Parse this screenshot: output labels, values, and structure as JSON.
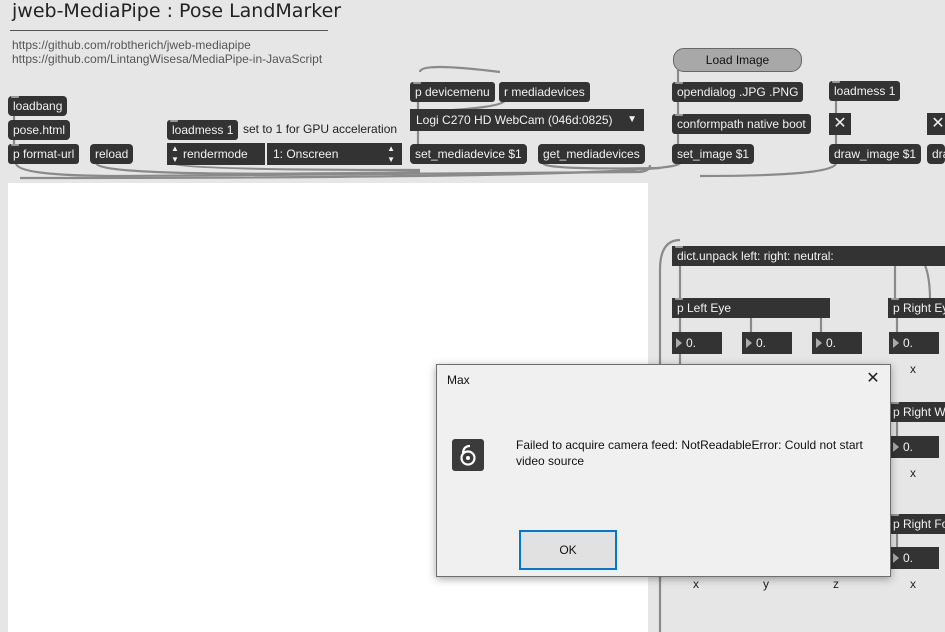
{
  "header": {
    "title": "jweb-MediaPipe : Pose LandMarker",
    "links": [
      "https://github.com/robtherich/jweb-mediapipe",
      "https://github.com/LintangWisesa/MediaPipe-in-JavaScript"
    ]
  },
  "objects": {
    "loadbang": "loadbang",
    "pose_html": "pose.html",
    "format_url": "p format-url",
    "reload": "reload",
    "loadmess1": "loadmess 1",
    "gpu_comment": "set to 1 for GPU acceleration",
    "rendermode": "rendermode",
    "render_menu": "1: Onscreen",
    "devicemenu": "p devicemenu",
    "mediadevices": "r mediadevices",
    "webcam_menu": "Logi C270 HD WebCam (046d:0825)",
    "set_mediadevice": "set_mediadevice $1",
    "get_mediadevices": "get_mediadevices",
    "load_image": "Load Image",
    "opendialog": "opendialog .JPG .PNG",
    "conformpath": "conformpath native boot",
    "set_image": "set_image $1",
    "loadmess1_b": "loadmess 1",
    "draw_image": "draw_image $1",
    "draw_partial": "dra",
    "dict_unpack": "dict.unpack left: right: neutral:",
    "left_eye": "p Left Eye",
    "right_eye": "p Right Ey",
    "right_w": "p Right W",
    "right_fo": "p Right Fo"
  },
  "numboxes": {
    "value": "0."
  },
  "axis_labels": {
    "x": "x",
    "y": "y",
    "z": "z"
  },
  "dialog": {
    "title": "Max",
    "close": "✕",
    "message": "Failed to acquire camera feed: NotReadableError: Could not start video source",
    "ok_label": "OK"
  },
  "icons": {
    "toggle": "close-x-icon",
    "menu_arrow": "triangle-down-icon"
  }
}
